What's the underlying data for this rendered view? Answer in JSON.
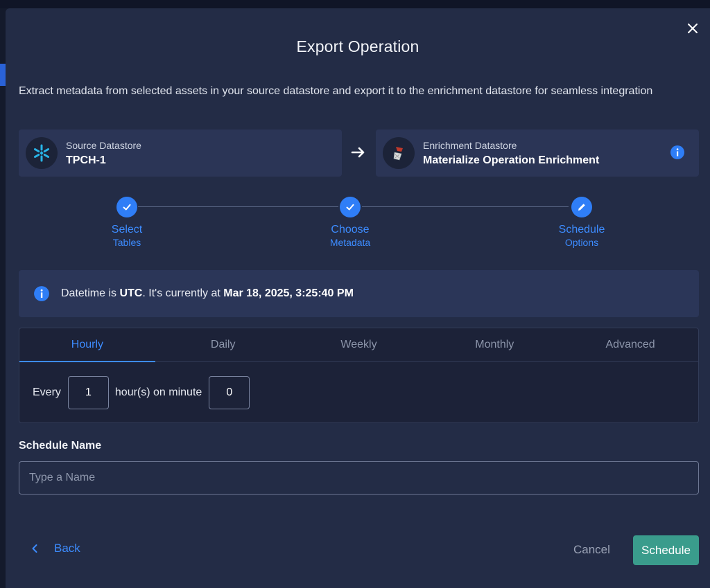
{
  "dialog": {
    "title": "Export Operation",
    "description": "Extract metadata from selected assets in your source datastore and export it to the enrichment datastore for seamless integration"
  },
  "source": {
    "label": "Source Datastore",
    "name": "TPCH-1",
    "icon": "snowflake-icon"
  },
  "enrichment": {
    "label": "Enrichment Datastore",
    "name": "Materialize Operation Enrichment",
    "icon": "materialize-logo-icon"
  },
  "steps": [
    {
      "title": "Select",
      "subtitle": "Tables",
      "state": "done"
    },
    {
      "title": "Choose",
      "subtitle": "Metadata",
      "state": "done"
    },
    {
      "title": "Schedule",
      "subtitle": "Options",
      "state": "current"
    }
  ],
  "timezone": {
    "prefix": "Datetime is ",
    "zone": "UTC",
    "middle": ". It's currently at ",
    "current": "Mar 18, 2025, 3:25:40 PM"
  },
  "schedule": {
    "tabs": [
      "Hourly",
      "Daily",
      "Weekly",
      "Monthly",
      "Advanced"
    ],
    "active_tab": "Hourly",
    "every_label": "Every",
    "every_value": "1",
    "unit_label": "hour(s) on minute",
    "minute_value": "0"
  },
  "name_field": {
    "label": "Schedule Name",
    "placeholder": "Type a Name",
    "value": ""
  },
  "footer": {
    "back": "Back",
    "cancel": "Cancel",
    "schedule": "Schedule"
  },
  "colors": {
    "accent": "#3d8cff",
    "primary_button": "#3a9c8c",
    "dialog_bg": "#232c46"
  }
}
